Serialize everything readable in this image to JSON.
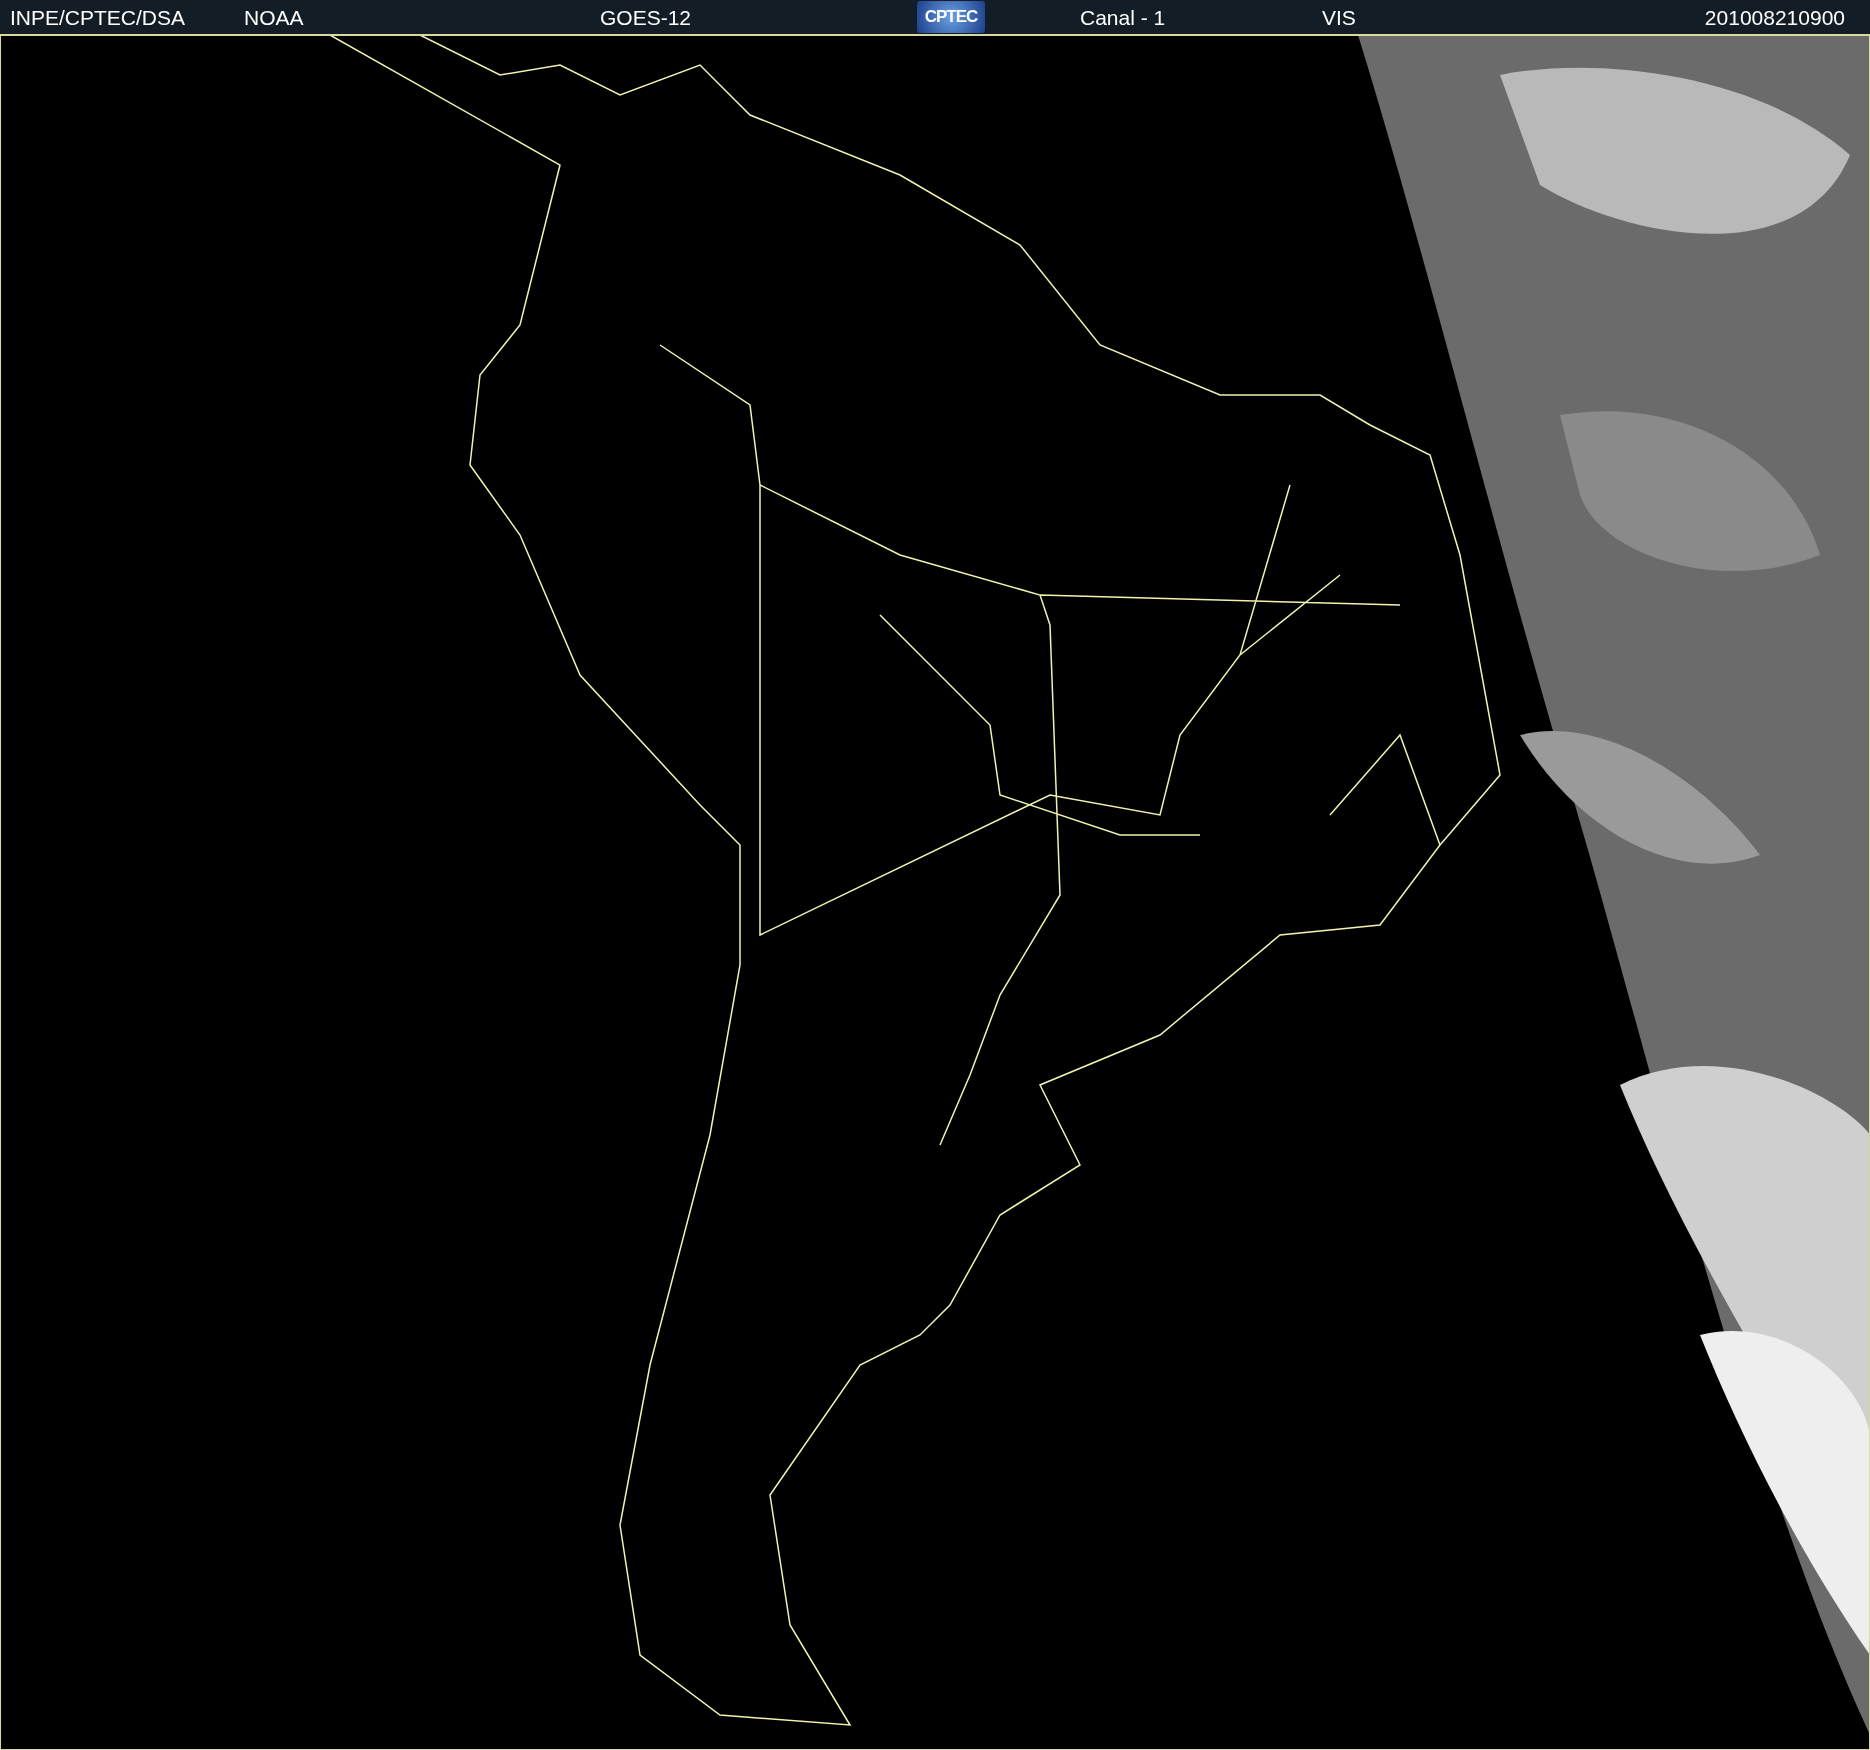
{
  "header": {
    "items": [
      {
        "kind": "text",
        "text": "INPE/CPTEC/DSA"
      },
      {
        "kind": "text",
        "text": "NOAA"
      },
      {
        "kind": "text",
        "text": "GOES-12"
      },
      {
        "kind": "logo",
        "text": "CPTEC"
      },
      {
        "kind": "text",
        "text": "Canal - 1"
      },
      {
        "kind": "text",
        "text": "VIS"
      },
      {
        "kind": "text",
        "text": "201008210900"
      }
    ]
  }
}
